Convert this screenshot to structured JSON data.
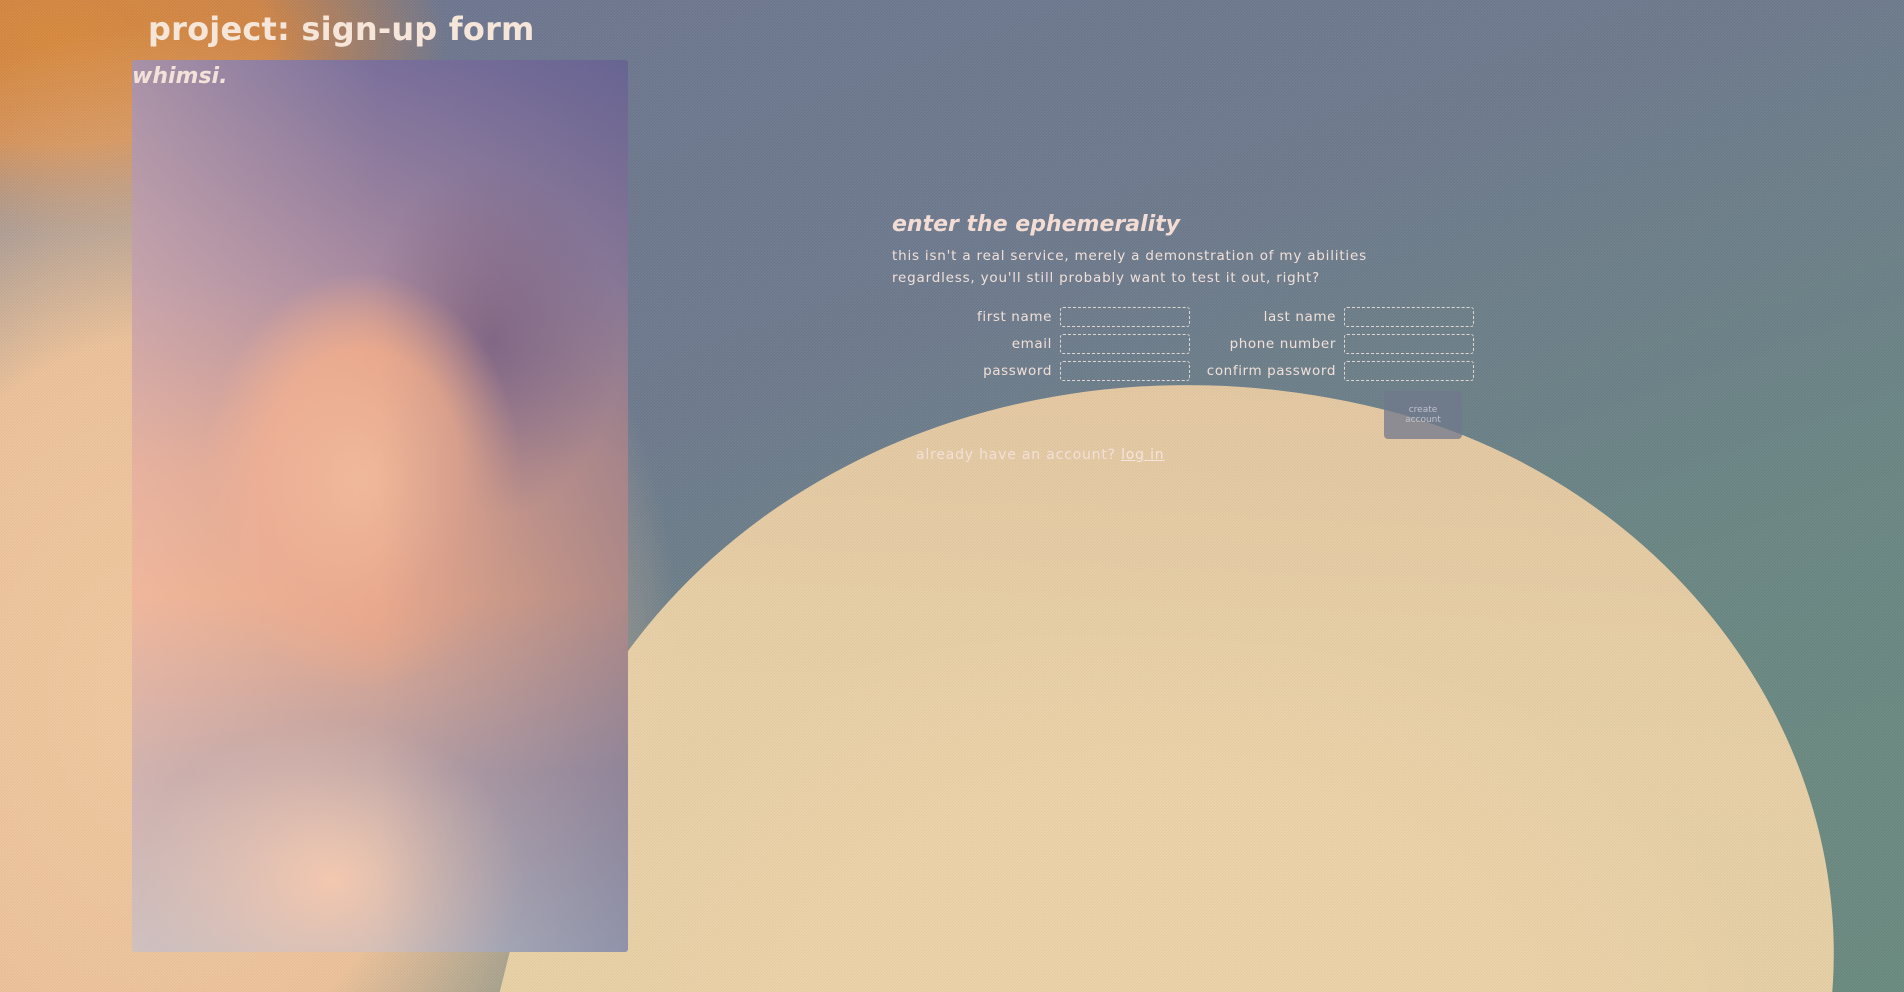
{
  "page": {
    "title": "project: sign-up form"
  },
  "hero": {
    "brand": "whimsi."
  },
  "form": {
    "heading": "enter the ephemerality",
    "subtitle_line1": "this isn't a real service, merely a demonstration of my abilities",
    "subtitle_line2": "regardless, you'll still probably want to test it out, right?",
    "fields": {
      "first_name_label": "first name",
      "last_name_label": "last name",
      "email_label": "email",
      "phone_label": "phone number",
      "password_label": "password",
      "confirm_password_label": "confirm password",
      "first_name_value": "",
      "last_name_value": "",
      "email_value": "",
      "phone_value": "",
      "password_value": "",
      "confirm_password_value": ""
    },
    "submit_label": "create account",
    "login_prompt": "already have an account?",
    "login_link": "log in"
  },
  "colors": {
    "text": "#f4e4dc",
    "button_bg": "#707890",
    "background_blue": "#6e7691",
    "background_sand": "#e9cfa2"
  }
}
